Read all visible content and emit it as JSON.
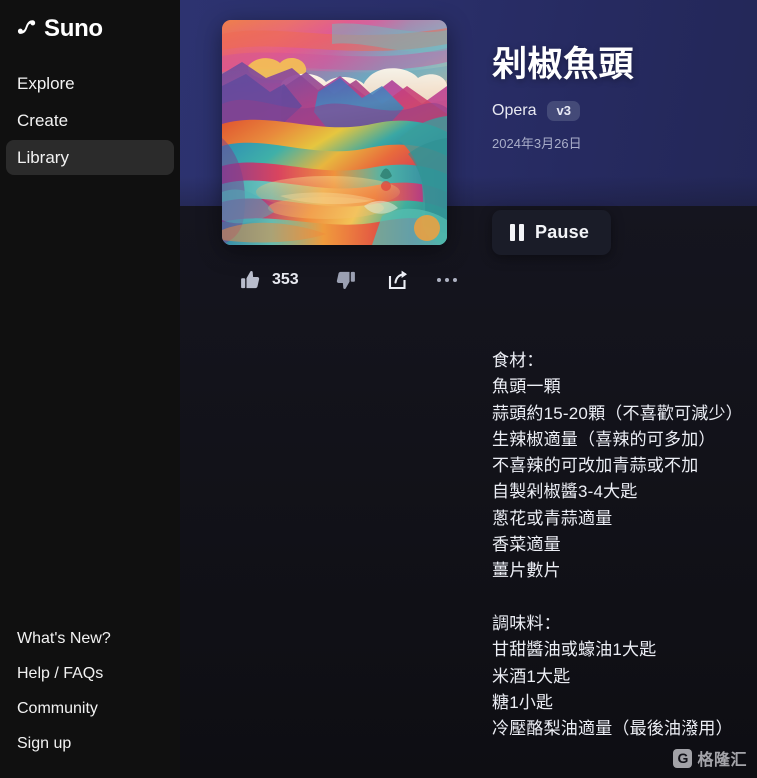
{
  "brand": {
    "name": "Suno",
    "logo_icon": "suno-music-note-icon"
  },
  "sidebar": {
    "top_items": [
      {
        "label": "Explore",
        "name": "sidebar-item-explore",
        "active": false
      },
      {
        "label": "Create",
        "name": "sidebar-item-create",
        "active": false
      },
      {
        "label": "Library",
        "name": "sidebar-item-library",
        "active": true
      }
    ],
    "bottom_items": [
      {
        "label": "What's New?",
        "name": "sidebar-item-whats-new"
      },
      {
        "label": "Help / FAQs",
        "name": "sidebar-item-help-faqs"
      },
      {
        "label": "Community",
        "name": "sidebar-item-community"
      },
      {
        "label": "Sign up",
        "name": "sidebar-item-sign-up"
      }
    ]
  },
  "song": {
    "title": "剁椒魚頭",
    "genre": "Opera",
    "version_badge": "v3",
    "date": "2024年3月26日",
    "cover_alt": "abstract colorful mountain valley landscape"
  },
  "player": {
    "pause_label": "Pause",
    "pause_icon": "pause-bars-icon"
  },
  "actions": {
    "like_icon": "thumbs-up-icon",
    "like_count": "353",
    "dislike_icon": "thumbs-down-icon",
    "share_icon": "share-arrow-icon",
    "more_icon": "more-horizontal-icon"
  },
  "description": "食材：\n魚頭一顆\n蒜頭約15-20顆（不喜歡可減少）\n生辣椒適量（喜辣的可多加）\n不喜辣的可改加青蒜或不加\n自製剁椒醬3-4大匙\n蔥花或青蒜適量\n香菜適量\n薑片數片\n\n調味料：\n甘甜醬油或蠔油1大匙\n米酒1大匙\n糖1小匙\n冷壓酪梨油適量（最後油潑用）",
  "watermark": {
    "logo_letter": "G",
    "text": "格隆汇"
  },
  "colors": {
    "sidebar_bg": "#101010",
    "hero_bg": "#2d3370",
    "body_bg": "#12121c",
    "accent_badge": "#444a78",
    "text_primary": "#ffffff",
    "text_muted": "#a9aec9"
  }
}
